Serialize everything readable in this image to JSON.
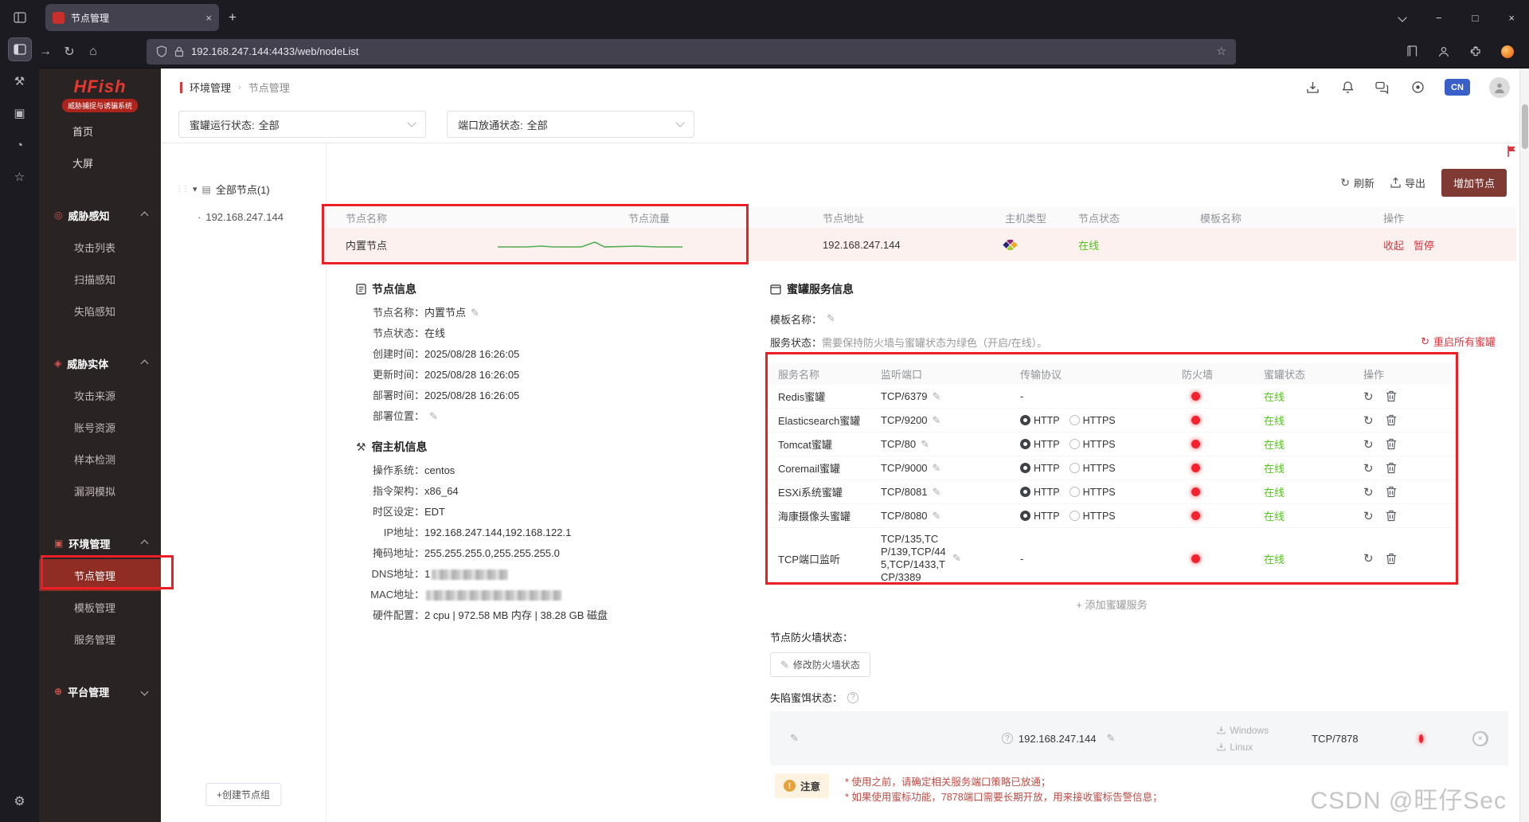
{
  "browser": {
    "tab_title": "节点管理",
    "url": "192.168.247.144:4433/web/nodeList"
  },
  "icons": {
    "pencil": "✎",
    "refresh": "↻",
    "gear": "⚙",
    "star": "☆",
    "tools": "⚒",
    "box": "▣",
    "clock": "◔",
    "caret_down": "▾",
    "dots": "⋮⋮",
    "layers": "▤",
    "home": "⌂",
    "back": "←",
    "forward": "→",
    "plus": "+",
    "close": "×",
    "minimize": "−",
    "maximize": "□",
    "bullet": "·",
    "question": "?",
    "exclaim": "!"
  },
  "sidebar": {
    "logo_title": "HFish",
    "logo_subtitle": "威胁捕捉与诱骗系统",
    "top_items": [
      "首页",
      "大屏"
    ],
    "groups": [
      {
        "label": "威胁感知",
        "icon": "radar",
        "expanded": true,
        "items": [
          {
            "label": "攻击列表"
          },
          {
            "label": "扫描感知"
          },
          {
            "label": "失陷感知"
          }
        ]
      },
      {
        "label": "威胁实体",
        "icon": "shield",
        "expanded": true,
        "items": [
          {
            "label": "攻击来源"
          },
          {
            "label": "账号资源"
          },
          {
            "label": "样本检测"
          },
          {
            "label": "漏洞模拟"
          }
        ]
      },
      {
        "label": "环境管理",
        "icon": "environment",
        "expanded": true,
        "items": [
          {
            "label": "节点管理",
            "active": true
          },
          {
            "label": "模板管理"
          },
          {
            "label": "服务管理"
          }
        ]
      },
      {
        "label": "平台管理",
        "icon": "platform",
        "expanded": false,
        "items": []
      }
    ]
  },
  "header": {
    "breadcrumb": {
      "parent": "环境管理",
      "current": "节点管理"
    },
    "lang_badge": "CN"
  },
  "filters": {
    "honeypot_label": "蜜罐运行状态:",
    "honeypot_value": "全部",
    "port_label": "端口放通状态:",
    "port_value": "全部"
  },
  "tree": {
    "root_label": "全部节点(1)",
    "node_ip": "192.168.247.144",
    "create_group": "+创建节点组"
  },
  "toolbar": {
    "refresh": "刷新",
    "export": "导出",
    "add_node": "增加节点"
  },
  "node_table": {
    "headers": [
      "节点名称",
      "节点流量",
      "节点地址",
      "主机类型",
      "节点状态",
      "模板名称",
      "操作"
    ],
    "row": {
      "name": "内置节点",
      "address": "192.168.247.144",
      "status": "在线",
      "action_collapse": "收起",
      "action_pause": "暂停"
    }
  },
  "node_info": {
    "title": "节点信息",
    "fields": [
      {
        "label": "节点名称：",
        "value": "内置节点",
        "editable": true
      },
      {
        "label": "节点状态：",
        "value": "在线"
      },
      {
        "label": "创建时间：",
        "value": "2025/08/28 16:26:05"
      },
      {
        "label": "更新时间：",
        "value": "2025/08/28 16:26:05"
      },
      {
        "label": "部署时间：",
        "value": "2025/08/28 16:26:05"
      },
      {
        "label": "部署位置：",
        "value": "",
        "editable": true
      }
    ]
  },
  "host_info": {
    "title": "宿主机信息",
    "fields": [
      {
        "label": "操作系统：",
        "value": "centos"
      },
      {
        "label": "指令架构：",
        "value": "x86_64"
      },
      {
        "label": "时区设定：",
        "value": "EDT"
      },
      {
        "label": "IP地址：",
        "value": "192.168.247.144,192.168.122.1"
      },
      {
        "label": "掩码地址：",
        "value": "255.255.255.0,255.255.255.0"
      },
      {
        "label": "DNS地址：",
        "value": "1",
        "redacted": true,
        "redacted_width": 96
      },
      {
        "label": "MAC地址：",
        "value": "",
        "redacted": true,
        "redacted_width": 170
      },
      {
        "label": "硬件配置：",
        "value": "2 cpu | 972.58 MB 内存 | 38.28 GB 磁盘"
      }
    ]
  },
  "services": {
    "title": "蜜罐服务信息",
    "template_label": "模板名称：",
    "status_label": "服务状态：",
    "status_hint": "需要保持防火墙与蜜罐状态为绿色（开启/在线）。",
    "restart_all": "重启所有蜜罐",
    "headers": [
      "服务名称",
      "监听端口",
      "传输协议",
      "防火墙",
      "蜜罐状态",
      "操作"
    ],
    "protocol_options": [
      "HTTP",
      "HTTPS"
    ],
    "protocol_selected": "HTTP",
    "rows": [
      {
        "name": "Redis蜜罐",
        "port": "TCP/6379",
        "protocol": "-",
        "status": "在线"
      },
      {
        "name": "Elasticsearch蜜罐",
        "port": "TCP/9200",
        "protocol": "http",
        "status": "在线"
      },
      {
        "name": "Tomcat蜜罐",
        "port": "TCP/80",
        "protocol": "http",
        "status": "在线"
      },
      {
        "name": "Coremail蜜罐",
        "port": "TCP/9000",
        "protocol": "http",
        "status": "在线"
      },
      {
        "name": "ESXi系统蜜罐",
        "port": "TCP/8081",
        "protocol": "http",
        "status": "在线"
      },
      {
        "name": "海康摄像头蜜罐",
        "port": "TCP/8080",
        "protocol": "http",
        "status": "在线"
      },
      {
        "name": "TCP端口监听",
        "port": "TCP/135,TCP/139,TCP/445,TCP/1433,TCP/3389",
        "protocol": "-",
        "status": "在线"
      }
    ],
    "add_service": "添加蜜罐服务",
    "firewall_label": "节点防火墙状态：",
    "modify_firewall": "修改防火墙状态",
    "bait_label": "失陷蜜饵状态：",
    "bait": {
      "ip": "192.168.247.144",
      "windows": "Windows",
      "linux": "Linux",
      "port": "TCP/7878"
    },
    "note_title": "注意",
    "note_lines": [
      "* 使用之前，请确定相关服务端口策略已放通；",
      "* 如果使用蜜标功能，7878端口需要长期开放，用来接收蜜标告警信息；"
    ]
  },
  "watermark": "CSDN @旺仔Sec",
  "colors": {
    "accent_red": "#d9363e",
    "status_green": "#52c41a",
    "firewall_red": "#f5222d",
    "annotation_red": "#eb1f25",
    "sidebar_active": "#8f2c24",
    "badge_blue": "#3a5fc8"
  }
}
